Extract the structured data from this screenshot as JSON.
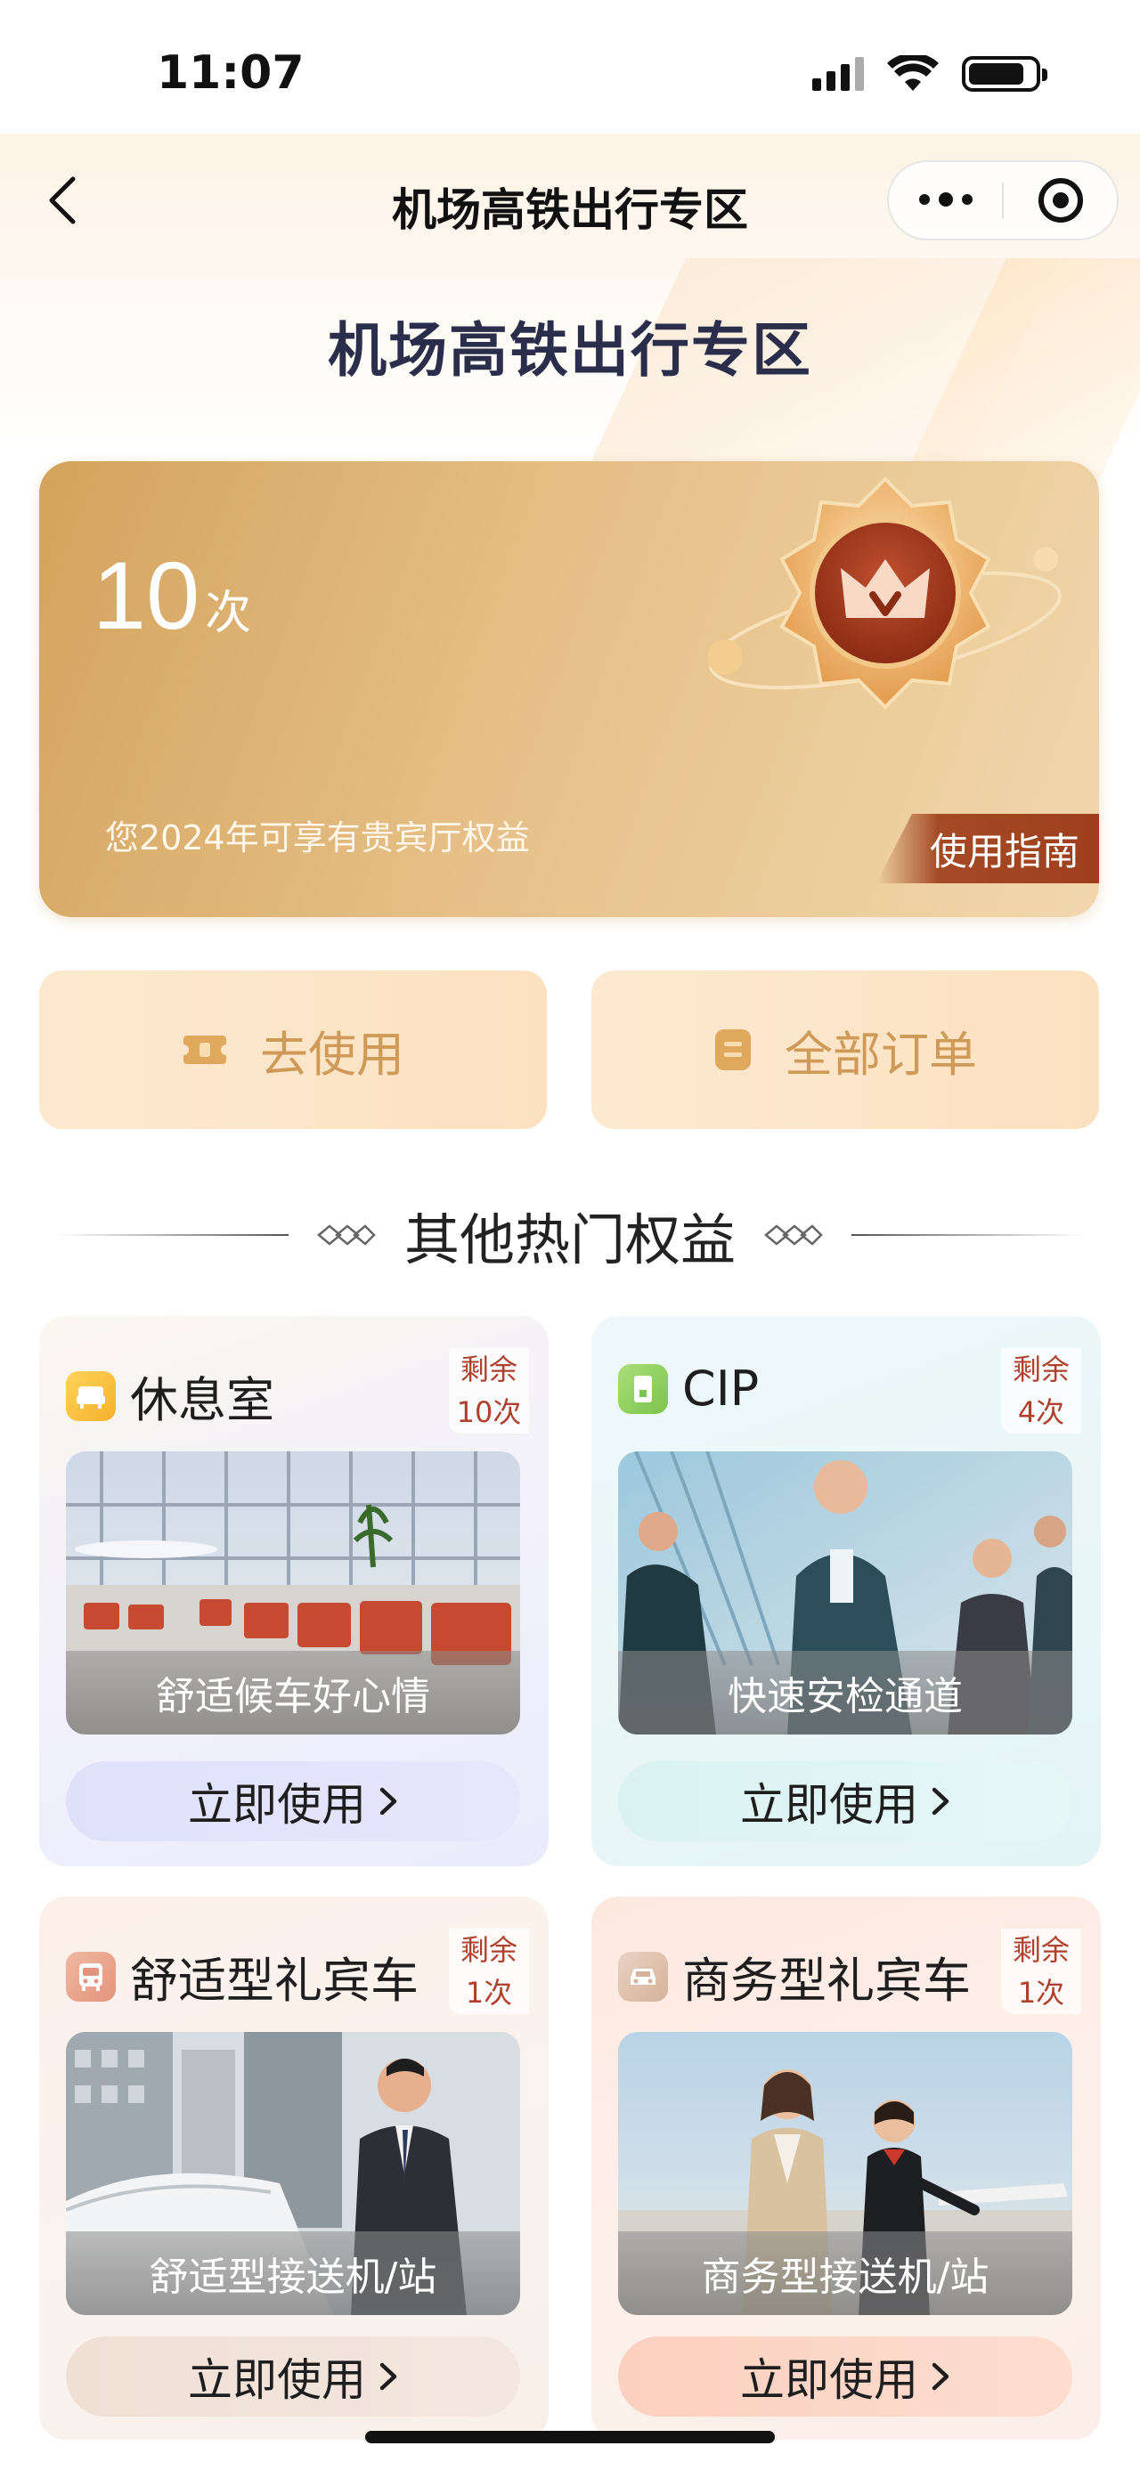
{
  "status_bar": {
    "time": "11:07"
  },
  "nav": {
    "title": "机场高铁出行专区"
  },
  "page": {
    "heading": "机场高铁出行专区"
  },
  "benefit": {
    "count": "10",
    "unit": "次",
    "description": "您2024年可享有贵宾厅权益",
    "guide_label": "使用指南"
  },
  "actions": {
    "use_label": "去使用",
    "orders_label": "全部订单"
  },
  "section": {
    "title": "其他热门权益"
  },
  "perks": [
    {
      "title": "休息室",
      "remain_label": "剩余",
      "remain_count": "10次",
      "caption": "舒适候车好心情",
      "button": "立即使用",
      "icon": "sofa-icon"
    },
    {
      "title": "CIP",
      "remain_label": "剩余",
      "remain_count": "4次",
      "caption": "快速安检通道",
      "button": "立即使用",
      "icon": "door-icon"
    },
    {
      "title": "舒适型礼宾车",
      "remain_label": "剩余",
      "remain_count": "1次",
      "caption": "舒适型接送机/站",
      "button": "立即使用",
      "icon": "bus-icon"
    },
    {
      "title": "商务型礼宾车",
      "remain_label": "剩余",
      "remain_count": "1次",
      "caption": "商务型接送机/站",
      "button": "立即使用",
      "icon": "car-icon"
    }
  ],
  "colors": {
    "heading": "#2a2e4a",
    "gold": "#d4a35d",
    "guide_bg": "#a44a24",
    "remain": "#b0402e",
    "action_text": "#cf9a58"
  }
}
